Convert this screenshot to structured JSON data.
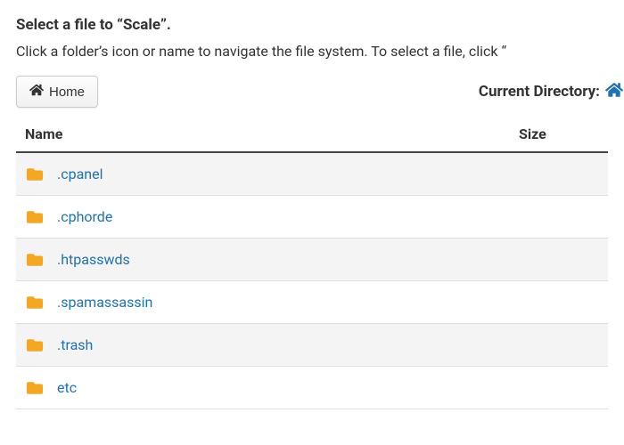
{
  "header": {
    "title": "Select a file to “Scale”.",
    "subtitle": "Click a folder’s icon or name to navigate the file system. To select a file, click “",
    "home_label": "Home",
    "current_dir_label": "Current Directory:",
    "breadcrumb_separator": "/"
  },
  "columns": {
    "name": "Name",
    "size": "Size"
  },
  "items": [
    {
      "name": ".cpanel",
      "type": "folder",
      "size": ""
    },
    {
      "name": ".cphorde",
      "type": "folder",
      "size": ""
    },
    {
      "name": ".htpasswds",
      "type": "folder",
      "size": ""
    },
    {
      "name": ".spamassassin",
      "type": "folder",
      "size": ""
    },
    {
      "name": ".trash",
      "type": "folder",
      "size": ""
    },
    {
      "name": "etc",
      "type": "folder",
      "size": ""
    }
  ],
  "colors": {
    "folder": "#f5a623",
    "link": "#2072b1"
  }
}
